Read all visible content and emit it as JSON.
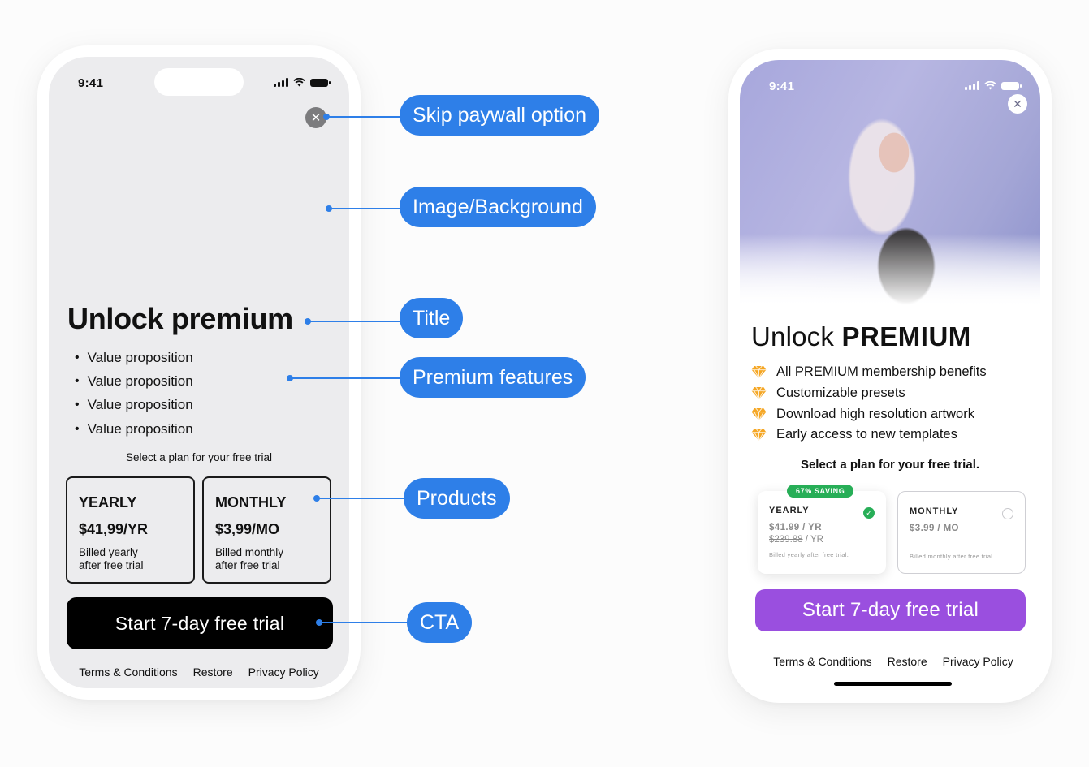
{
  "wireframe": {
    "status": {
      "time": "9:41"
    },
    "close_icon": "close-icon",
    "title": "Unlock premium",
    "features": [
      "Value proposition",
      "Value proposition",
      "Value proposition",
      "Value proposition"
    ],
    "select_plan_text": "Select a plan for your free trial",
    "products": [
      {
        "name": "YEARLY",
        "price": "$41,99/YR",
        "description_line1": "Billed yearly",
        "description_line2": "after free trial"
      },
      {
        "name": "MONTHLY",
        "price": "$3,99/MO",
        "description_line1": "Billed monthly",
        "description_line2": "after free trial"
      }
    ],
    "cta_label": "Start 7-day free trial",
    "footer_links": [
      "Terms & Conditions",
      "Restore",
      "Privacy Policy"
    ]
  },
  "callouts": [
    {
      "label": "Skip paywall option"
    },
    {
      "label": "Image/Background"
    },
    {
      "label": "Title"
    },
    {
      "label": "Premium features"
    },
    {
      "label": "Products"
    },
    {
      "label": "CTA"
    }
  ],
  "example": {
    "status": {
      "time": "9:41"
    },
    "title_regular": "Unlock ",
    "title_bold": "PREMIUM",
    "feature_icon": "gem-icon",
    "features": [
      "All PREMIUM membership benefits",
      "Customizable presets",
      "Download high resolution artwork",
      "Early access to new templates"
    ],
    "select_plan_text": "Select a plan for your free trial.",
    "products": [
      {
        "badge": "67% SAVING",
        "name": "YEARLY",
        "price": "$41.99 / YR",
        "old_price": "$239.88",
        "old_price_suffix": " / YR",
        "description": "Billed yearly after free trial.",
        "selected": true
      },
      {
        "name": "MONTHLY",
        "price": "$3.99 / MO",
        "description": "Billed monthly after free trial..",
        "selected": false
      }
    ],
    "cta_label": "Start 7-day free trial",
    "footer_links": [
      "Terms & Conditions",
      "Restore",
      "Privacy Policy"
    ]
  },
  "colors": {
    "callout_blue": "#2e7fe8",
    "cta_purple": "#9a4fdf",
    "saving_green": "#27ae57",
    "gem_orange": "#f5a623",
    "wireframe_bg": "#ececee"
  }
}
